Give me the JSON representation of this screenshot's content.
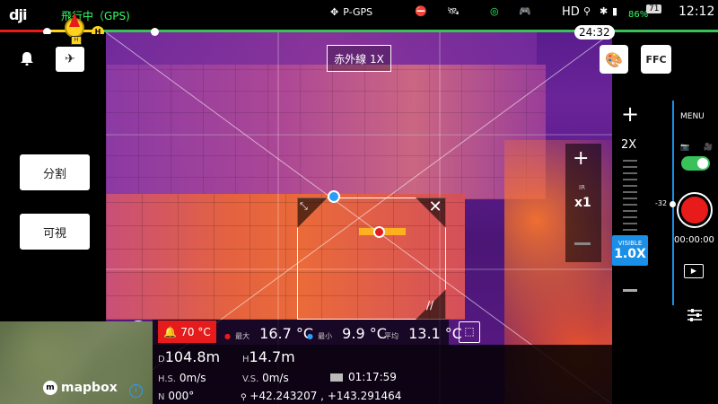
{
  "topbar": {
    "flight_status": "飛行中（GPS)",
    "mode": "P-GPS",
    "hd_label": "HD",
    "battery_pct": "86%",
    "battery_box": "71",
    "clock": "12:12"
  },
  "progress": {
    "remaining_time": "24:32",
    "home_marker": "H",
    "colors": {
      "red": "#e81b1b",
      "yellow": "#ffd31a",
      "green": "#3ac25a"
    }
  },
  "left": {
    "split_label": "分割",
    "visible_label": "可視"
  },
  "camera": {
    "ir_label": "赤外線 1X",
    "ffc_label": "FFC"
  },
  "zoom": {
    "max_label": "2X",
    "visible_top": "VISIBLE",
    "visible_value": "1.0X",
    "ir_small": "IR",
    "ir_value": "x1"
  },
  "recording": {
    "menu_label": "MENU",
    "ev_value": "-32",
    "rec_time": "00:00:00"
  },
  "temperature": {
    "alarm_value": "70 °C",
    "max_label": "最大",
    "max_value": "16.7 °C",
    "min_label": "最小",
    "min_value": "9.9 °C",
    "avg_label": "平均",
    "avg_value": "13.1 °C"
  },
  "telemetry": {
    "d_label": "D",
    "d_value": "104.8m",
    "h_label": "H",
    "h_value": "14.7m",
    "hs_label": "H.S.",
    "hs_value": "0m/s",
    "vs_label": "V.S.",
    "vs_value": "0m/s",
    "flight_time": "01:17:59",
    "n_label": "N",
    "heading": "000°",
    "coords": "+42.243207 , +143.291464"
  },
  "map": {
    "attribution": "mapbox",
    "home_icon": "H"
  }
}
